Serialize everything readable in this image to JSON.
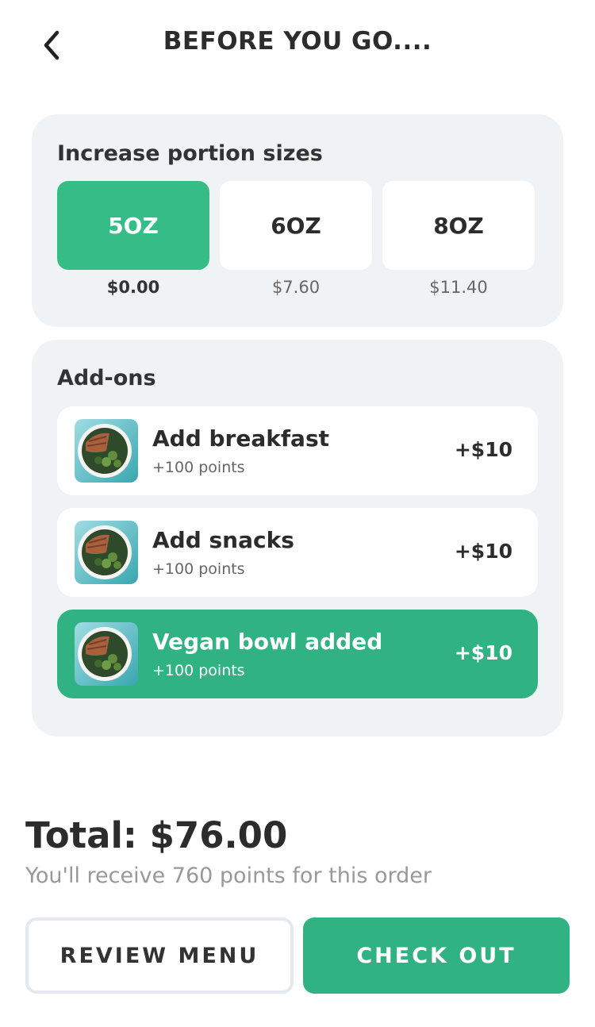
{
  "header": {
    "title": "BEFORE YOU GO....",
    "back_icon": "chevron-left-icon"
  },
  "portion": {
    "title": "Increase portion sizes",
    "options": [
      {
        "label": "5OZ",
        "price": "$0.00",
        "selected": true
      },
      {
        "label": "6OZ",
        "price": "$7.60",
        "selected": false
      },
      {
        "label": "8OZ",
        "price": "$11.40",
        "selected": false
      }
    ]
  },
  "addons": {
    "title": "Add-ons",
    "items": [
      {
        "name": "Add breakfast",
        "points": "+100 points",
        "price": "+$10",
        "active": false
      },
      {
        "name": "Add snacks",
        "points": "+100 points",
        "price": "+$10",
        "active": false
      },
      {
        "name": "Vegan bowl added",
        "points": "+100 points",
        "price": "+$10",
        "active": true
      }
    ]
  },
  "summary": {
    "total": "Total: $76.00",
    "points_note": "You'll receive 760 points for this order"
  },
  "actions": {
    "review_label": "REVIEW MENU",
    "checkout_label": "CHECK OUT"
  },
  "colors": {
    "accent": "#31b283",
    "selected_size": "#35bc87",
    "card_bg": "#f0f3f6"
  }
}
